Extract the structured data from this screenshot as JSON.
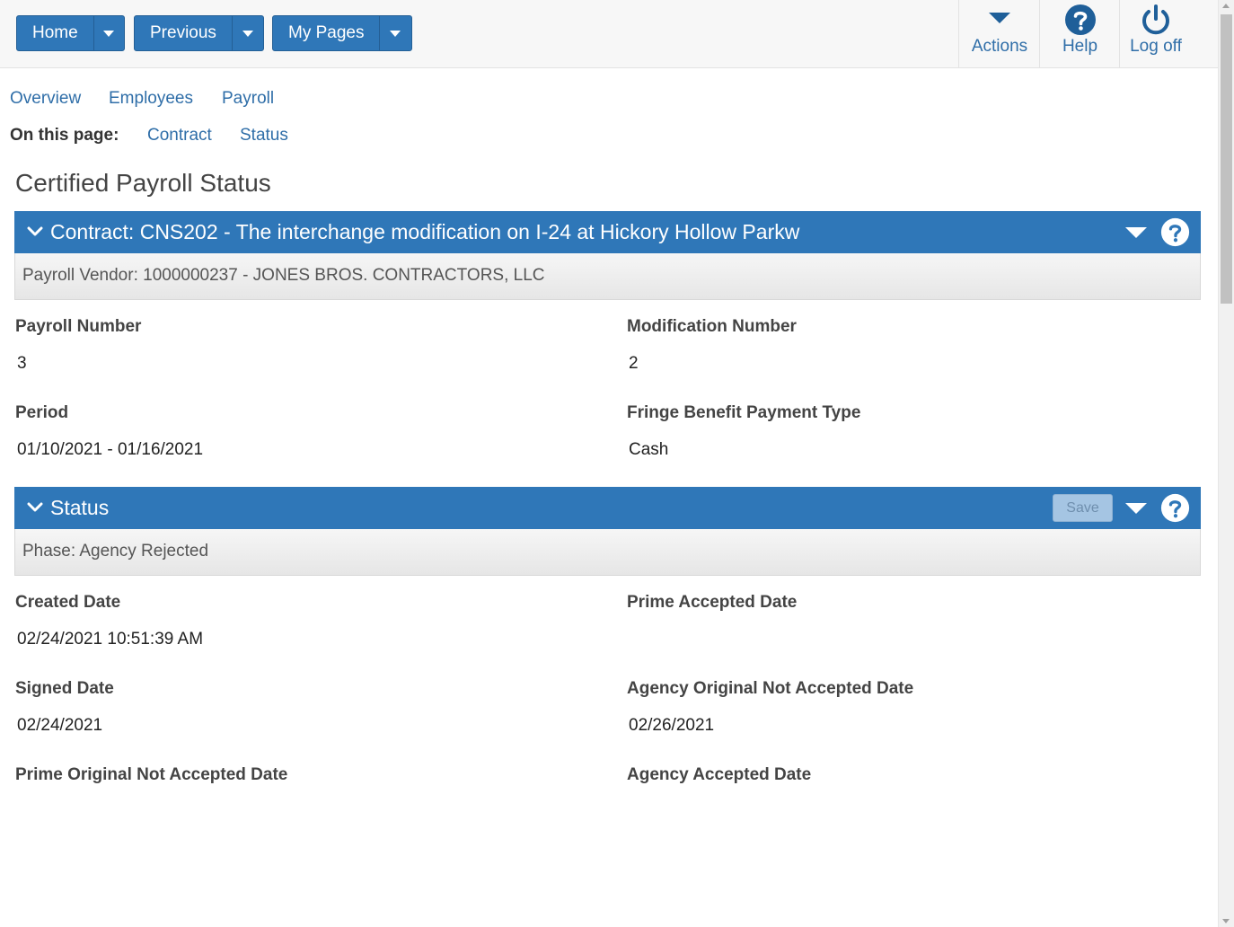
{
  "topbar": {
    "home_label": "Home",
    "previous_label": "Previous",
    "my_pages_label": "My Pages",
    "actions_label": "Actions",
    "help_label": "Help",
    "logoff_label": "Log off"
  },
  "nav": {
    "links": [
      "Overview",
      "Employees",
      "Payroll"
    ],
    "on_this_page_label": "On this page:",
    "page_links": [
      "Contract",
      "Status"
    ]
  },
  "page": {
    "title": "Certified Payroll Status"
  },
  "contract_panel": {
    "title": "Contract: CNS202 - The interchange modification on I-24 at Hickory Hollow Parkw",
    "subheader": "Payroll Vendor: 1000000237 - JONES BROS. CONTRACTORS, LLC",
    "fields": {
      "payroll_number_label": "Payroll Number",
      "payroll_number_value": "3",
      "modification_number_label": "Modification Number",
      "modification_number_value": "2",
      "period_label": "Period",
      "period_value": "01/10/2021 - 01/16/2021",
      "fringe_label": "Fringe Benefit Payment Type",
      "fringe_value": "Cash"
    }
  },
  "status_panel": {
    "title": "Status",
    "save_label": "Save",
    "subheader": "Phase: Agency Rejected",
    "fields": {
      "created_date_label": "Created Date",
      "created_date_value": "02/24/2021 10:51:39 AM",
      "prime_accepted_label": "Prime Accepted Date",
      "prime_accepted_value": "",
      "signed_date_label": "Signed Date",
      "signed_date_value": "02/24/2021",
      "agency_orig_not_accepted_label": "Agency Original Not Accepted Date",
      "agency_orig_not_accepted_value": "02/26/2021",
      "prime_orig_not_accepted_label": "Prime Original Not Accepted Date",
      "agency_accepted_label": "Agency Accepted Date"
    }
  },
  "colors": {
    "brand_blue": "#2f77b8",
    "link_blue": "#2f6ea8",
    "save_disabled": "#a5c5e3"
  },
  "icons": [
    "chevron-down-icon",
    "caret-down-icon",
    "question-circle-icon",
    "power-icon"
  ]
}
